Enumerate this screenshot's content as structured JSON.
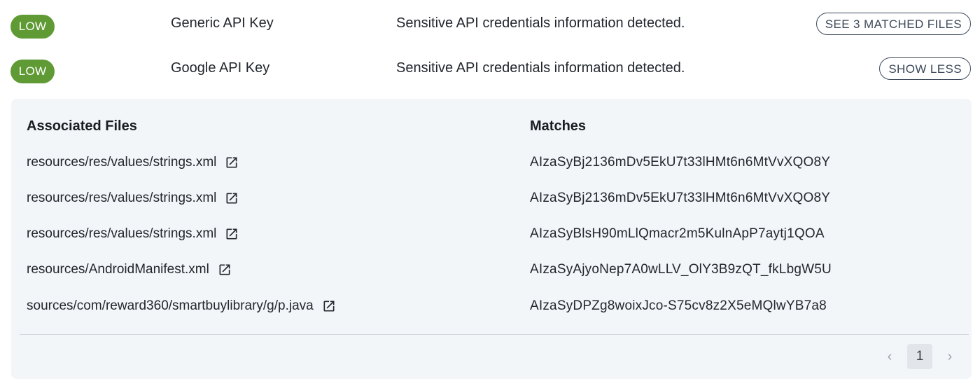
{
  "findings": [
    {
      "severity": "LOW",
      "name": "Generic API Key",
      "description": "Sensitive API credentials information detected.",
      "action_label": "SEE 3 MATCHED FILES"
    },
    {
      "severity": "LOW",
      "name": "Google API Key",
      "description": "Sensitive API credentials information detected.",
      "action_label": "SHOW LESS"
    }
  ],
  "colors": {
    "severity_low": "#5f9a35",
    "panel_bg": "#f3f6f9",
    "button_border": "#3d4a5a"
  },
  "details": {
    "files_header": "Associated Files",
    "matches_header": "Matches",
    "rows": [
      {
        "file": "resources/res/values/strings.xml",
        "match": "AIzaSyBj2136mDv5EkU7t33lHMt6n6MtVvXQO8Y",
        "icon": "external-link-icon"
      },
      {
        "file": "resources/res/values/strings.xml",
        "match": "AIzaSyBj2136mDv5EkU7t33lHMt6n6MtVvXQO8Y",
        "icon": "external-link-icon"
      },
      {
        "file": "resources/res/values/strings.xml",
        "match": "AIzaSyBlsH90mLlQmacr2m5KulnApP7aytj1QOA",
        "icon": "external-link-icon"
      },
      {
        "file": "resources/AndroidManifest.xml",
        "match": "AIzaSyAjyoNep7A0wLLV_OlY3B9zQT_fkLbgW5U",
        "icon": "external-link-icon"
      },
      {
        "file": "sources/com/reward360/smartbuylibrary/g/p.java",
        "match": "AIzaSyDPZg8woixJco-S75cv8z2X5eMQlwYB7a8",
        "icon": "external-link-icon"
      }
    ]
  },
  "pagination": {
    "prev_icon": "chevron-left-icon",
    "current_page": "1",
    "next_icon": "chevron-right-icon"
  }
}
